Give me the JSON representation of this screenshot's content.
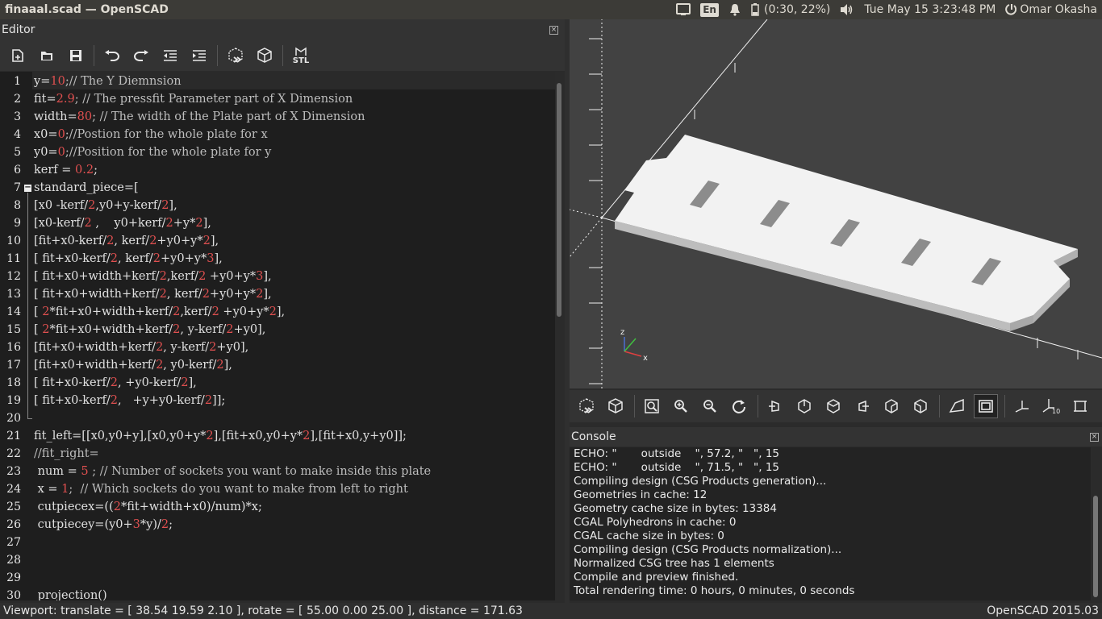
{
  "window": {
    "title": "finaaal.scad — OpenSCAD"
  },
  "tray": {
    "lang": "En",
    "battery": "(0:30, 22%)",
    "datetime": "Tue May 15  3:23:48 PM",
    "user": "Omar Okasha"
  },
  "editor": {
    "title": "Editor",
    "toolbar": [
      "new-file-icon",
      "open-file-icon",
      "save-icon",
      "undo-icon",
      "redo-icon",
      "unindent-icon",
      "indent-icon",
      "preview-icon",
      "render-icon",
      "export-stl-icon"
    ],
    "stl_label": "STL",
    "lines": [
      {
        "n": "1",
        "segs": [
          [
            "y",
            "t"
          ],
          [
            "=",
            "t"
          ],
          [
            "10",
            "n"
          ],
          [
            ";// The Y Diemnsion",
            "c"
          ]
        ]
      },
      {
        "n": "2",
        "segs": [
          [
            "fit=",
            "t"
          ],
          [
            "2.9",
            "n"
          ],
          [
            "; // The pressfit Parameter part of X Dimension",
            "c"
          ]
        ]
      },
      {
        "n": "3",
        "segs": [
          [
            "width=",
            "t"
          ],
          [
            "80",
            "n"
          ],
          [
            "; // The width of the Plate part of X Dimension",
            "c"
          ]
        ]
      },
      {
        "n": "4",
        "segs": [
          [
            "x0=",
            "t"
          ],
          [
            "0",
            "n"
          ],
          [
            ";//Postion for the whole plate for x",
            "c"
          ]
        ]
      },
      {
        "n": "5",
        "segs": [
          [
            "y0=",
            "t"
          ],
          [
            "0",
            "n"
          ],
          [
            ";//Position for the whole plate for y",
            "c"
          ]
        ]
      },
      {
        "n": "6",
        "segs": [
          [
            "kerf = ",
            "t"
          ],
          [
            "0.2",
            "n"
          ],
          [
            ";",
            "t"
          ]
        ]
      },
      {
        "n": "7",
        "segs": [
          [
            "standard_piece=[",
            "t"
          ]
        ]
      },
      {
        "n": "8",
        "segs": [
          [
            "[x0 -kerf/",
            "t"
          ],
          [
            "2",
            "n"
          ],
          [
            ",y0+y-kerf/",
            "t"
          ],
          [
            "2",
            "n"
          ],
          [
            "],",
            "t"
          ]
        ]
      },
      {
        "n": "9",
        "segs": [
          [
            "[x0-kerf/",
            "t"
          ],
          [
            "2",
            "n"
          ],
          [
            " ,    y0+kerf/",
            "t"
          ],
          [
            "2",
            "n"
          ],
          [
            "+y*",
            "t"
          ],
          [
            "2",
            "n"
          ],
          [
            "],",
            "t"
          ]
        ]
      },
      {
        "n": "10",
        "segs": [
          [
            "[fit+x0-kerf/",
            "t"
          ],
          [
            "2",
            "n"
          ],
          [
            ", kerf/",
            "t"
          ],
          [
            "2",
            "n"
          ],
          [
            "+y0+y*",
            "t"
          ],
          [
            "2",
            "n"
          ],
          [
            "],",
            "t"
          ]
        ]
      },
      {
        "n": "11",
        "segs": [
          [
            "[ fit+x0-kerf/",
            "t"
          ],
          [
            "2",
            "n"
          ],
          [
            ", kerf/",
            "t"
          ],
          [
            "2",
            "n"
          ],
          [
            "+y0+y*",
            "t"
          ],
          [
            "3",
            "n"
          ],
          [
            "],",
            "t"
          ]
        ]
      },
      {
        "n": "12",
        "segs": [
          [
            "[ fit+x0+width+kerf/",
            "t"
          ],
          [
            "2",
            "n"
          ],
          [
            ",kerf/",
            "t"
          ],
          [
            "2",
            "n"
          ],
          [
            " +y0+y*",
            "t"
          ],
          [
            "3",
            "n"
          ],
          [
            "],",
            "t"
          ]
        ]
      },
      {
        "n": "13",
        "segs": [
          [
            "[ fit+x0+width+kerf/",
            "t"
          ],
          [
            "2",
            "n"
          ],
          [
            ", kerf/",
            "t"
          ],
          [
            "2",
            "n"
          ],
          [
            "+y0+y*",
            "t"
          ],
          [
            "2",
            "n"
          ],
          [
            "],",
            "t"
          ]
        ]
      },
      {
        "n": "14",
        "segs": [
          [
            "[ ",
            "t"
          ],
          [
            "2",
            "n"
          ],
          [
            "*fit+x0+width+kerf/",
            "t"
          ],
          [
            "2",
            "n"
          ],
          [
            ",kerf/",
            "t"
          ],
          [
            "2",
            "n"
          ],
          [
            " +y0+y*",
            "t"
          ],
          [
            "2",
            "n"
          ],
          [
            "],",
            "t"
          ]
        ]
      },
      {
        "n": "15",
        "segs": [
          [
            "[ ",
            "t"
          ],
          [
            "2",
            "n"
          ],
          [
            "*fit+x0+width+kerf/",
            "t"
          ],
          [
            "2",
            "n"
          ],
          [
            ", y-kerf/",
            "t"
          ],
          [
            "2",
            "n"
          ],
          [
            "+y0],",
            "t"
          ]
        ]
      },
      {
        "n": "16",
        "segs": [
          [
            "[fit+x0+width+kerf/",
            "t"
          ],
          [
            "2",
            "n"
          ],
          [
            ", y-kerf/",
            "t"
          ],
          [
            "2",
            "n"
          ],
          [
            "+y0],",
            "t"
          ]
        ]
      },
      {
        "n": "17",
        "segs": [
          [
            "[fit+x0+width+kerf/",
            "t"
          ],
          [
            "2",
            "n"
          ],
          [
            ", y0-kerf/",
            "t"
          ],
          [
            "2",
            "n"
          ],
          [
            "],",
            "t"
          ]
        ]
      },
      {
        "n": "18",
        "segs": [
          [
            "[ fit+x0-kerf/",
            "t"
          ],
          [
            "2",
            "n"
          ],
          [
            ", +y0-kerf/",
            "t"
          ],
          [
            "2",
            "n"
          ],
          [
            "],",
            "t"
          ]
        ]
      },
      {
        "n": "19",
        "segs": [
          [
            "[ fit+x0-kerf/",
            "t"
          ],
          [
            "2",
            "n"
          ],
          [
            ",   +y+y0-kerf/",
            "t"
          ],
          [
            "2",
            "n"
          ],
          [
            "]];",
            "t"
          ]
        ]
      },
      {
        "n": "20",
        "segs": []
      },
      {
        "n": "21",
        "segs": [
          [
            "fit_left=[[x0,y0+y],[x0,y0+y*",
            "t"
          ],
          [
            "2",
            "n"
          ],
          [
            "],[fit+x0,y0+y*",
            "t"
          ],
          [
            "2",
            "n"
          ],
          [
            "],[fit+x0,y+y0]];",
            "t"
          ]
        ]
      },
      {
        "n": "22",
        "segs": [
          [
            "//fit_right=",
            "c"
          ]
        ]
      },
      {
        "n": "23",
        "segs": [
          [
            " num = ",
            "t"
          ],
          [
            "5",
            "n"
          ],
          [
            " ; // Number of sockets you want to make inside this plate",
            "c"
          ]
        ]
      },
      {
        "n": "24",
        "segs": [
          [
            " x = ",
            "t"
          ],
          [
            "1",
            "n"
          ],
          [
            ";  // Which sockets do you want to make from left to right",
            "c"
          ]
        ]
      },
      {
        "n": "25",
        "segs": [
          [
            " cutpiecex=((",
            "t"
          ],
          [
            "2",
            "n"
          ],
          [
            "*fit+width+x0)/num)*x;",
            "t"
          ]
        ]
      },
      {
        "n": "26",
        "segs": [
          [
            " cutpiecey=(y0+",
            "t"
          ],
          [
            "3",
            "n"
          ],
          [
            "*y)/",
            "t"
          ],
          [
            "2",
            "n"
          ],
          [
            ";",
            "t"
          ]
        ]
      },
      {
        "n": "27",
        "segs": []
      },
      {
        "n": "28",
        "segs": []
      },
      {
        "n": "29",
        "segs": []
      },
      {
        "n": "30",
        "segs": [
          [
            " projection()",
            "t"
          ]
        ]
      }
    ]
  },
  "viewport": {
    "toolbar": [
      "preview-icon",
      "render-icon",
      "view-all-icon",
      "zoom-in-icon",
      "zoom-out-icon",
      "reset-view-icon",
      "view-right-icon",
      "view-top-icon",
      "view-bottom-icon",
      "view-left-icon",
      "view-front-icon",
      "view-back-icon",
      "perspective-icon",
      "orthogonal-icon",
      "show-axes-icon",
      "show-scale-markers-icon",
      "show-edges-icon"
    ],
    "axis_labels": {
      "x": "x",
      "z": "z"
    }
  },
  "console": {
    "title": "Console",
    "lines": [
      "ECHO: \"       outside    \", 57.2, \"   \", 15",
      "ECHO: \"       outside    \", 71.5, \"   \", 15",
      "Compiling design (CSG Products generation)...",
      "Geometries in cache: 12",
      "Geometry cache size in bytes: 13384",
      "CGAL Polyhedrons in cache: 0",
      "CGAL cache size in bytes: 0",
      "Compiling design (CSG Products normalization)...",
      "Normalized CSG tree has 1 elements",
      "Compile and preview finished.",
      "Total rendering time: 0 hours, 0 minutes, 0 seconds"
    ]
  },
  "status": {
    "viewport": "Viewport: translate = [ 38.54 19.59 2.10 ], rotate = [ 55.00 0.00 25.00 ], distance = 171.63",
    "version": "OpenSCAD 2015.03"
  },
  "colors": {
    "number": "#e05050",
    "comment": "#bdbdbd",
    "text": "#e0e0e0",
    "plate": "#f2f2f2",
    "plate_side": "#bfbfbf",
    "viewport_bg": "#424242"
  }
}
